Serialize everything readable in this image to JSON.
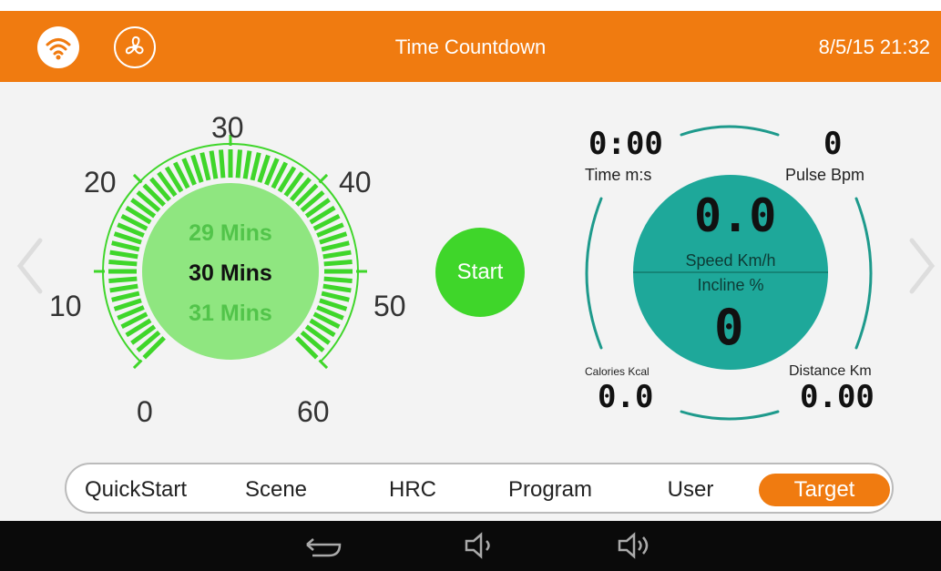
{
  "topbar": {
    "title": "Time Countdown",
    "datetime": "8/5/15 21:32",
    "icons": [
      "wifi-icon",
      "fan-icon"
    ]
  },
  "dial": {
    "tick_labels": [
      "0",
      "10",
      "20",
      "30",
      "40",
      "50",
      "60"
    ],
    "unit_suffix": "Mins",
    "prev_value": "29 Mins",
    "current_value": "30 Mins",
    "next_value": "31 Mins",
    "selected_minutes": 30
  },
  "start_button": {
    "label": "Start"
  },
  "stats": {
    "time_value": "0:00",
    "time_label": "Time m:s",
    "pulse_value": "0",
    "pulse_label": "Pulse Bpm",
    "speed_value": "0.0",
    "speed_label": "Speed Km/h",
    "incline_label": "Incline %",
    "incline_value": "0",
    "calories_label": "Calories Kcal",
    "calories_value": "0.0",
    "distance_label": "Distance Km",
    "distance_value": "0.00"
  },
  "tabs": [
    {
      "label": "QuickStart",
      "active": false
    },
    {
      "label": "Scene",
      "active": false
    },
    {
      "label": "HRC",
      "active": false
    },
    {
      "label": "Program",
      "active": false
    },
    {
      "label": "User",
      "active": false
    },
    {
      "label": "Target",
      "active": true
    }
  ],
  "system_bar": {
    "icons": [
      "back-icon",
      "volume-down-icon",
      "volume-up-icon"
    ]
  },
  "colors": {
    "accent": "#f07b10",
    "dial_green": "#3fd62a",
    "gauge_teal": "#1ea89a",
    "ring_teal": "#1e9a8c"
  }
}
